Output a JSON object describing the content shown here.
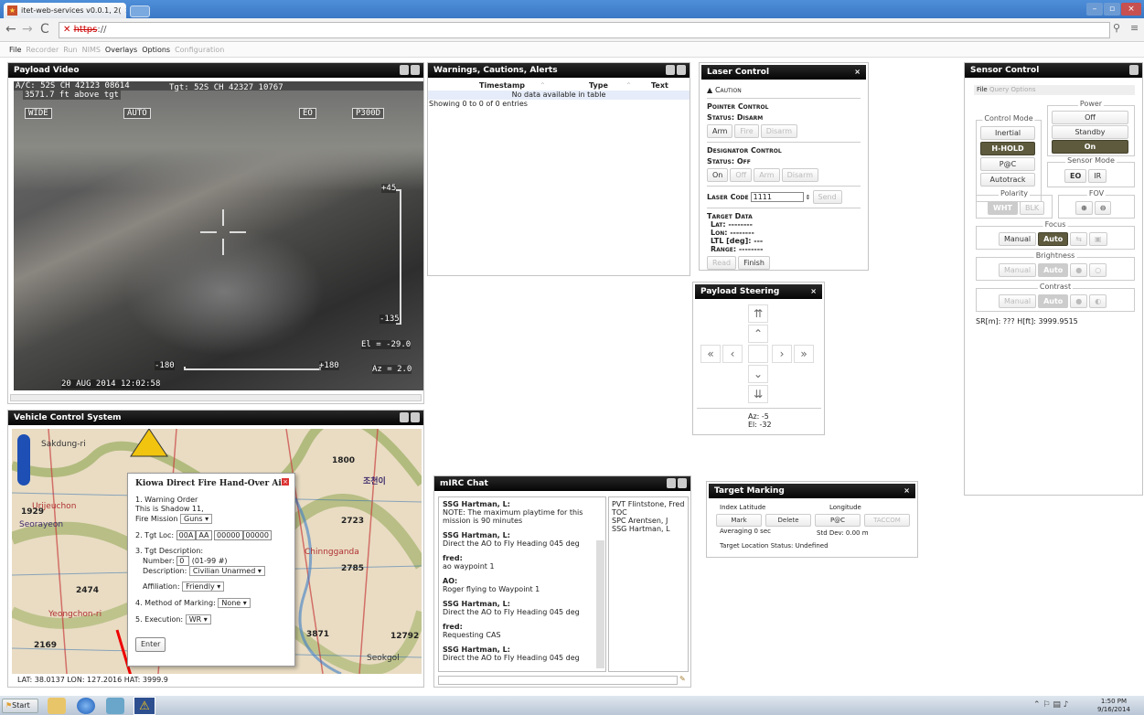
{
  "browser": {
    "tab_title": "itet-web-services v0.0.1, 2(",
    "close": "×",
    "url_scheme_struck": "https",
    "url_rest": "://"
  },
  "app_menu": [
    {
      "label": "File",
      "enabled": true
    },
    {
      "label": "Recorder",
      "enabled": false
    },
    {
      "label": "Run",
      "enabled": false
    },
    {
      "label": "NIMS",
      "enabled": false
    },
    {
      "label": "Overlays",
      "enabled": true
    },
    {
      "label": "Options",
      "enabled": true
    },
    {
      "label": "Configuration",
      "enabled": false
    }
  ],
  "payload_video": {
    "title": "Payload Video",
    "ac_line": "A/C: 52S CH 42123 08614",
    "tgt_line": "Tgt: 52S CH 42327 10767",
    "alt": "3571.7 ft  above tgt",
    "mode_wide": "WIDE",
    "mode_auto": "AUTO",
    "mode_eo": "EO",
    "mode_p300": "P300D",
    "scale_top": "+45",
    "scale_bottom": "-135",
    "el_readout": "El = -29.0",
    "az_readout": "Az = 2.0",
    "az_left": "-180",
    "az_right": "+180",
    "date": "20 AUG 2014 12:02:58"
  },
  "wca": {
    "title": "Warnings, Cautions, Alerts",
    "columns": [
      "Timestamp",
      "Type",
      "Text"
    ],
    "empty": "No data available in table",
    "info": "Showing 0 to 0 of 0 entries"
  },
  "laser": {
    "title": "Laser Control",
    "caution": "Caution",
    "pointer_heading": "Pointer Control",
    "pointer_status": "Status: Disarm",
    "pointer_buttons": [
      "Arm",
      "Fire",
      "Disarm"
    ],
    "designator_heading": "Designator Control",
    "designator_status": "Status: Off",
    "designator_buttons": [
      "On",
      "Off",
      "Arm",
      "Disarm"
    ],
    "code_label": "Laser Code",
    "code_value": "1111",
    "send": "Send",
    "target_heading": "Target Data",
    "lat": "Lat:  --------",
    "lon": "Lon:  --------",
    "ltl": "LTL [deg]:  ---",
    "range": "Range:  --------",
    "read": "Read",
    "finish": "Finish"
  },
  "steering": {
    "title": "Payload Steering",
    "az": "Az:  -5",
    "el": "El:  -32"
  },
  "sensor": {
    "title": "Sensor Control",
    "menu": [
      "File",
      "Query",
      "Options"
    ],
    "power_label": "Power",
    "power": [
      "Off",
      "Standby",
      "On"
    ],
    "control_label": "Control Mode",
    "control": [
      "Inertial",
      "H-HOLD",
      "P@C",
      "Autotrack"
    ],
    "sensor_mode_label": "Sensor Mode",
    "sensor_mode": [
      "EO",
      "IR"
    ],
    "polarity_label": "Polarity",
    "polarity": [
      "WHT",
      "BLK"
    ],
    "fov_label": "FOV",
    "focus_label": "Focus",
    "brightness_label": "Brightness",
    "contrast_label": "Contrast",
    "manual": "Manual",
    "auto": "Auto",
    "readout": "SR[m]:  ???  H[ft]:  3999.9515"
  },
  "vcs": {
    "title": "Vehicle Control System",
    "status": "LAT: 38.0137    LON: 127.2016    HAT: 3999.9",
    "map_labels": [
      "조천이",
      "Urijeuchon",
      "Chinngganda",
      "Seorayeon",
      "1929",
      "2474",
      "2169",
      "3871",
      "2723",
      "1800",
      "2785",
      "12792",
      "Sakdung-ri",
      "Yeongchon-ri",
      "Seokgol"
    ],
    "dialog": {
      "title": "Kiowa Direct Fire Hand-Over Air",
      "l1": "1. Warning Order",
      "l1a": "This is Shadow 11,",
      "l1b": "Fire Mission",
      "fire_mission": "Guns",
      "l2": "2. Tgt Loc:",
      "tgt_loc": [
        "00A",
        "AA",
        "00000",
        "00000"
      ],
      "l3": "3. Tgt Description:",
      "number_label": "Number:",
      "number": "0",
      "number_hint": "(01-99 #)",
      "desc_label": "Description:",
      "desc": "Civilian Unarmed",
      "aff_label": "Affiliation:",
      "aff": "Friendly",
      "l4": "4. Method of Marking:",
      "marking": "None",
      "l5": "5. Execution:",
      "execution": "WR",
      "enter": "Enter"
    }
  },
  "chat": {
    "title": "mIRC Chat",
    "messages": [
      {
        "from": "SSG Hartman, L:",
        "text": "NOTE: The maximum playtime for this mission is 90 minutes"
      },
      {
        "from": "SSG Hartman, L:",
        "text": "Direct the AO to Fly Heading 045 deg"
      },
      {
        "from": "fred:",
        "text": "ao waypoint 1"
      },
      {
        "from": "AO:",
        "text": "Roger flying to Waypoint 1"
      },
      {
        "from": "SSG Hartman, L:",
        "text": "Direct the AO to Fly Heading 045 deg"
      },
      {
        "from": "fred:",
        "text": "Requesting CAS"
      },
      {
        "from": "SSG Hartman, L:",
        "text": "Direct the AO to Fly Heading 045 deg"
      }
    ],
    "users": [
      "PVT Flintstone, Fred",
      "TOC",
      "SPC Arentsen, J",
      "SSG Hartman, L"
    ]
  },
  "marking": {
    "title": "Target Marking",
    "index": "Index",
    "latitude": "Latitude",
    "longitude": "Longitude",
    "buttons": [
      "Mark",
      "Delete",
      "P@C",
      "TACCOM"
    ],
    "averaging": "Averaging  0  sec",
    "stddev": "Std Dev:  0.00  m",
    "status": "Target Location Status:  Undefined"
  },
  "taskbar": {
    "start": "Start",
    "time": "1:50 PM",
    "date": "9/16/2014"
  }
}
